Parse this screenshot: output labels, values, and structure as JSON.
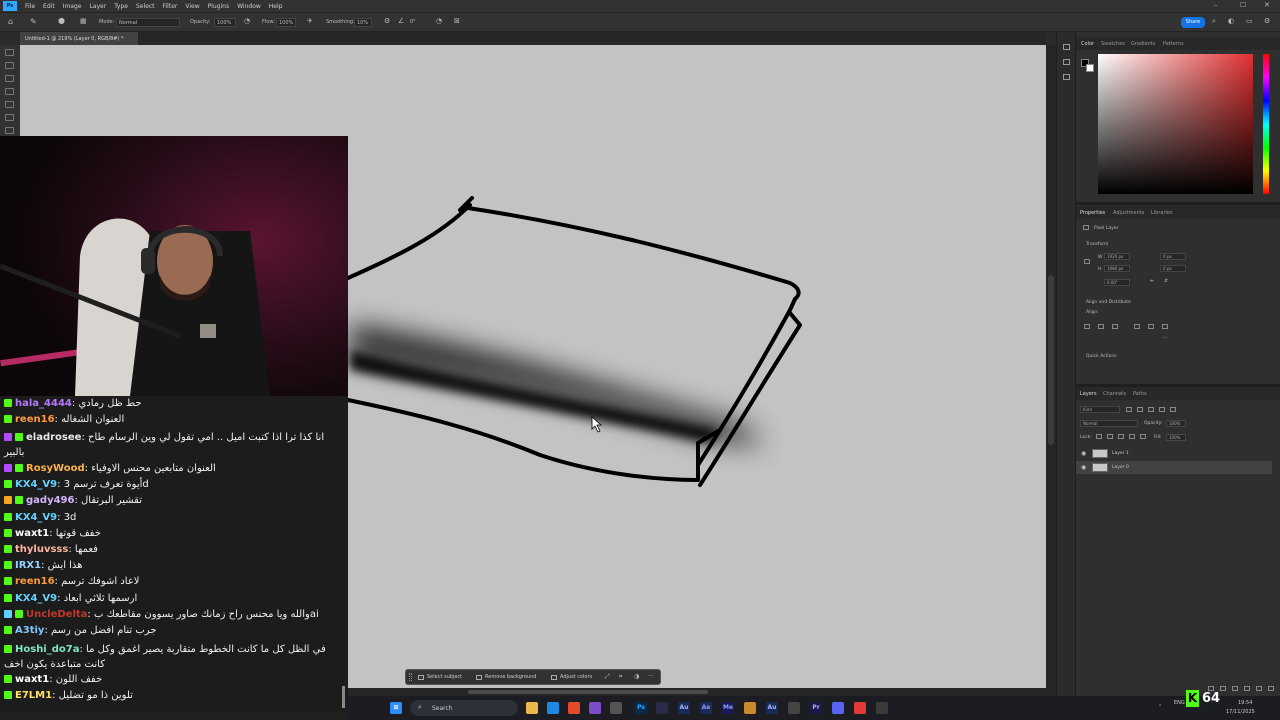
{
  "app": {
    "name": "Ps",
    "menu": [
      "File",
      "Edit",
      "Image",
      "Layer",
      "Type",
      "Select",
      "Filter",
      "View",
      "Plugins",
      "Window",
      "Help"
    ]
  },
  "options_bar": {
    "mode_label": "Mode:",
    "mode_value": "Normal",
    "opacity_label": "Opacity:",
    "opacity_value": "100%",
    "flow_label": "Flow:",
    "flow_value": "100%",
    "smoothing_label": "Smoothing:",
    "smoothing_value": "10%",
    "angle_value": "0°",
    "share_label": "Share"
  },
  "document": {
    "tab_title": "Untitled-1 @ 219% (Layer 0, RGB/8#) *"
  },
  "context_taskbar": {
    "select_subject": "Select subject",
    "remove_background": "Remove background",
    "adjust_colors": "Adjust colors",
    "more": "···"
  },
  "color_panel": {
    "tabs": [
      "Color",
      "Swatches",
      "Gradients",
      "Patterns"
    ],
    "active_tab": "Color",
    "foreground": "#000000",
    "background": "#ffffff"
  },
  "properties_panel": {
    "tabs": [
      "Properties",
      "Adjustments",
      "Libraries"
    ],
    "active_tab": "Properties",
    "pixel_layer": "Pixel Layer",
    "transform_title": "Transform",
    "w_label": "W",
    "w_value": "1920 px",
    "x_value": "0 px",
    "h_label": "H",
    "h_value": "1080 px",
    "y_value": "0 px",
    "angle_value": "0.00°",
    "align_title": "Align and Distribute",
    "align_label": "Align:",
    "quick_actions": "Quick Actions"
  },
  "layers_panel": {
    "tabs": [
      "Layers",
      "Channels",
      "Paths"
    ],
    "active_tab": "Layers",
    "kind": "Kind",
    "blend_mode": "Normal",
    "opacity_label": "Opacity:",
    "opacity_value": "100%",
    "lock_label": "Lock:",
    "fill_label": "Fill:",
    "fill_value": "100%",
    "layers": [
      {
        "name": "Layer 1",
        "selected": false
      },
      {
        "name": "Layer 0",
        "selected": true
      }
    ]
  },
  "chat": {
    "messages": [
      {
        "user": "hala_4444",
        "color": "#b678ff",
        "badges": [
          "#53fc18"
        ],
        "text": "حط ظل رمادي"
      },
      {
        "user": "reen16",
        "color": "#ff9a3c",
        "badges": [
          "#53fc18"
        ],
        "text": "العنوان الشغاله"
      },
      {
        "user": "eladrosee",
        "color": "#e8e8e8",
        "badges": [
          "#b24dff",
          "#53fc18"
        ],
        "text": "انا كذا ترا اذا كتبت اميل .. امي تقول لي وين الرسام طاح بالبير"
      },
      {
        "user": "RosyWood",
        "color": "#ffb347",
        "badges": [
          "#b24dff",
          "#53fc18"
        ],
        "text": "العنوان متابعين محنس الاوفياء"
      },
      {
        "user": "KX4_V9",
        "color": "#5fd3ff",
        "badges": [
          "#53fc18"
        ],
        "text": "أيوة تعرف ترسم 3d"
      },
      {
        "user": "gady496",
        "color": "#d6b4ff",
        "badges": [
          "#f5a623",
          "#53fc18"
        ],
        "text": "تقشير البرتقال"
      },
      {
        "user": "KX4_V9",
        "color": "#5fd3ff",
        "badges": [
          "#53fc18"
        ],
        "text": "3d"
      },
      {
        "user": "waxt1",
        "color": "#ffffff",
        "badges": [
          "#53fc18"
        ],
        "text": "خفف قوتها"
      },
      {
        "user": "thyluvsss",
        "color": "#ffb3a0",
        "badges": [
          "#53fc18"
        ],
        "text": "فعمها"
      },
      {
        "user": "IRX1",
        "color": "#8fd3ff",
        "badges": [
          "#53fc18"
        ],
        "text": "هذا ايش"
      },
      {
        "user": "reen16",
        "color": "#ff9a3c",
        "badges": [
          "#53fc18"
        ],
        "text": "لاعاد اشوفك ترسم"
      },
      {
        "user": "KX4_V9",
        "color": "#5fd3ff",
        "badges": [
          "#53fc18"
        ],
        "text": "ارسمها ثلاثي ابعاد"
      },
      {
        "user": "UncleDelta",
        "color": "#c0392b",
        "badges": [
          "#5fd3ff",
          "#53fc18"
        ],
        "text": "والله ويا محنس راح زمانك صاور يسوون مقاطعك بai"
      },
      {
        "user": "A3tiy",
        "color": "#7ec8ff",
        "badges": [
          "#53fc18"
        ],
        "text": "جرب تنام افضل من رسم"
      },
      {
        "user": "Hoshi_do7a",
        "color": "#7ee8c0",
        "badges": [
          "#53fc18"
        ],
        "text": "في الظل كل ما كانت الخطوط متقاربة يصير اغمق وكل ما كانت متباعدة يكون اخف"
      },
      {
        "user": "waxt1",
        "color": "#ffffff",
        "badges": [
          "#53fc18"
        ],
        "text": "خفف اللون"
      },
      {
        "user": "E7LM1",
        "color": "#ffe066",
        "badges": [
          "#53fc18"
        ],
        "text": "تلوين ذا مو تضليل"
      }
    ]
  },
  "windows_taskbar": {
    "search_placeholder": "Search",
    "language": "ENG",
    "time": "19:54",
    "date": "17/11/2025",
    "viewer_count": "64"
  }
}
